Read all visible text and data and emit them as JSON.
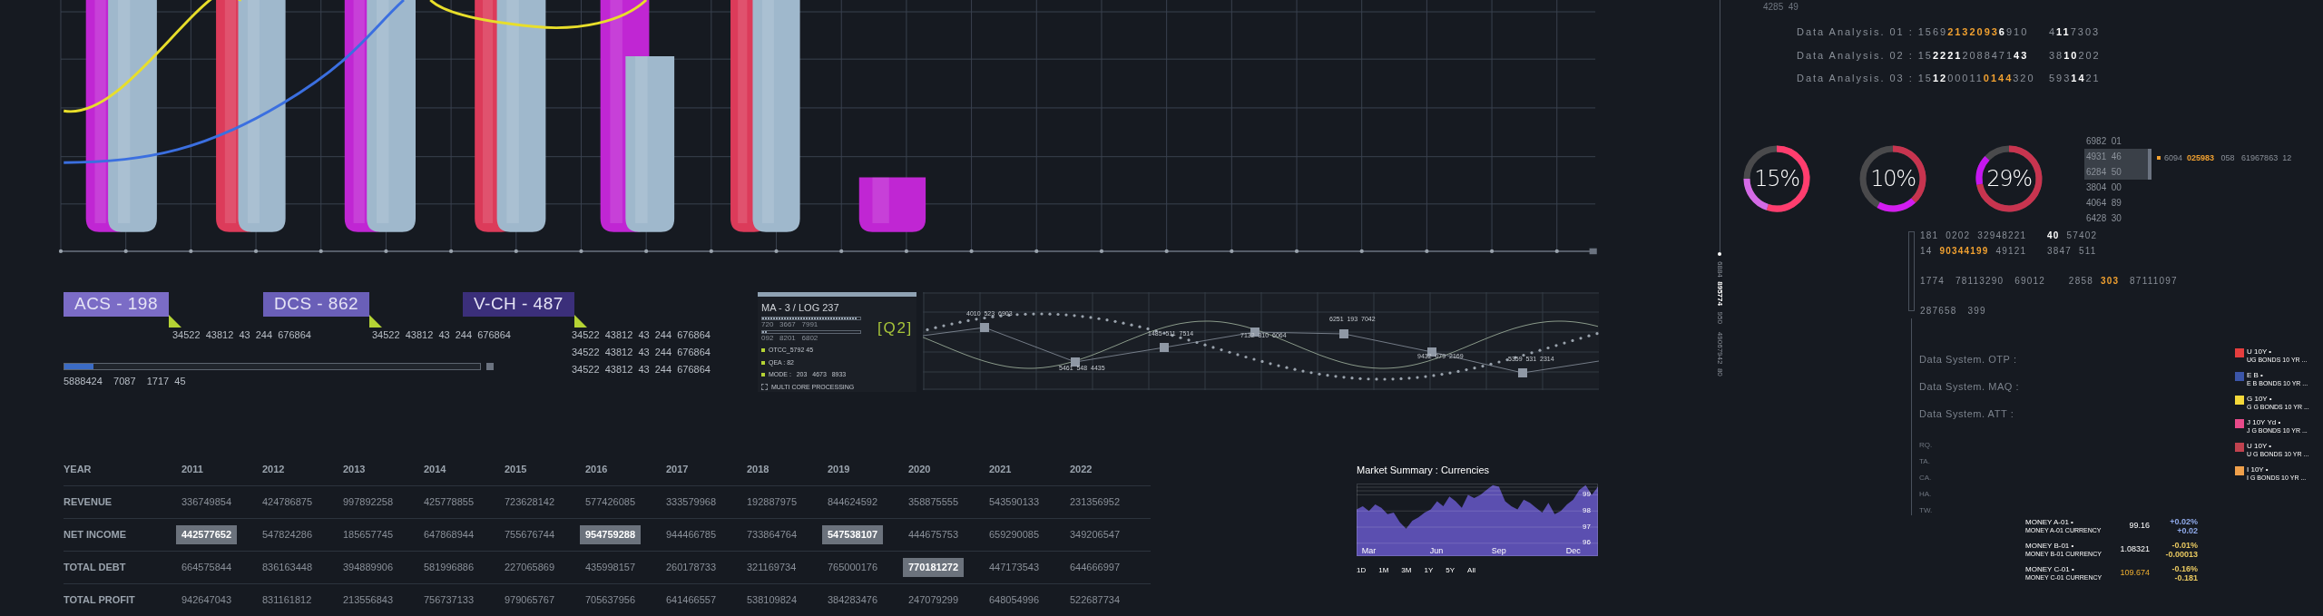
{
  "tags": [
    {
      "label": "ACS - 198",
      "color": "#7b6cc6",
      "lines": [
        "34522  43812  43  244  676864"
      ]
    },
    {
      "label": "DCS - 862",
      "color": "#6a5fb8",
      "lines": [
        "34522  43812  43  244  676864"
      ]
    },
    {
      "label": "V-CH - 487",
      "color": "#3b2f7a",
      "lines": [
        "34522  43812  43  244  676864",
        "34522  43812  43  244  676864",
        "34522  43812  43  244  676864"
      ]
    }
  ],
  "progress": {
    "level": 0.07,
    "reading": "5888424    7087    1717  45"
  },
  "log_panel": {
    "title": "MA - 3 / LOG 237",
    "badge": "[Q2]",
    "meters": [
      {
        "level": 0.97,
        "reading": "720   3667   7991"
      },
      {
        "level": 0.05,
        "reading": "092   8201   6802"
      }
    ],
    "items": [
      {
        "kind": "bullet",
        "text": "OTCC_5792 45"
      },
      {
        "kind": "bullet",
        "text": "QEA : 82"
      },
      {
        "kind": "bullet",
        "text": "MODE :   203   4673   8933"
      },
      {
        "kind": "task",
        "text": "MULTI CORE PROCESSING"
      }
    ]
  },
  "wave_labels": [
    "4010  523  6903",
    "5461  548  4435",
    "1485  511  7514",
    "7132  310  6064",
    "6251  193  7042",
    "9432  079  2169",
    "5359  531  2314"
  ],
  "table": {
    "header": "YEAR",
    "columns": [
      "2011",
      "2012",
      "2013",
      "2014",
      "2015",
      "2016",
      "2017",
      "2018",
      "2019",
      "2020",
      "2021",
      "2022"
    ],
    "rows": [
      {
        "label": "REVENUE",
        "cells": [
          {
            "value": "336749854",
            "highlighted": false
          },
          {
            "value": "424786875",
            "highlighted": false
          },
          {
            "value": "997892258",
            "highlighted": false
          },
          {
            "value": "425778855",
            "highlighted": false
          },
          {
            "value": "723628142",
            "highlighted": false
          },
          {
            "value": "577426085",
            "highlighted": false
          },
          {
            "value": "333579968",
            "highlighted": false
          },
          {
            "value": "192887975",
            "highlighted": false
          },
          {
            "value": "844624592",
            "highlighted": false
          },
          {
            "value": "358875555",
            "highlighted": false
          },
          {
            "value": "543590133",
            "highlighted": false
          },
          {
            "value": "231356952",
            "highlighted": false
          }
        ]
      },
      {
        "label": "NET INCOME",
        "cells": [
          {
            "value": "442577652",
            "highlighted": true
          },
          {
            "value": "547824286",
            "highlighted": false
          },
          {
            "value": "185657745",
            "highlighted": false
          },
          {
            "value": "647868944",
            "highlighted": false
          },
          {
            "value": "755676744",
            "highlighted": false
          },
          {
            "value": "954759288",
            "highlighted": true
          },
          {
            "value": "944466785",
            "highlighted": false
          },
          {
            "value": "733864764",
            "highlighted": false
          },
          {
            "value": "547538107",
            "highlighted": true
          },
          {
            "value": "444675753",
            "highlighted": false
          },
          {
            "value": "659290085",
            "highlighted": false
          },
          {
            "value": "349206547",
            "highlighted": false
          }
        ]
      },
      {
        "label": "TOTAL DEBT",
        "cells": [
          {
            "value": "664575844",
            "highlighted": false
          },
          {
            "value": "836163448",
            "highlighted": false
          },
          {
            "value": "394889906",
            "highlighted": false
          },
          {
            "value": "581996886",
            "highlighted": false
          },
          {
            "value": "227065869",
            "highlighted": false
          },
          {
            "value": "435998157",
            "highlighted": false
          },
          {
            "value": "260178733",
            "highlighted": false
          },
          {
            "value": "321169734",
            "highlighted": false
          },
          {
            "value": "765000176",
            "highlighted": false
          },
          {
            "value": "770181272",
            "highlighted": true
          },
          {
            "value": "447173543",
            "highlighted": false
          },
          {
            "value": "644666997",
            "highlighted": false
          }
        ]
      },
      {
        "label": "TOTAL PROFIT",
        "cells": [
          {
            "value": "942647043",
            "highlighted": false
          },
          {
            "value": "831161812",
            "highlighted": false
          },
          {
            "value": "213556843",
            "highlighted": false
          },
          {
            "value": "756737133",
            "highlighted": false
          },
          {
            "value": "979065767",
            "highlighted": false
          },
          {
            "value": "705637956",
            "highlighted": false
          },
          {
            "value": "641466557",
            "highlighted": false
          },
          {
            "value": "538109824",
            "highlighted": false
          },
          {
            "value": "384283476",
            "highlighted": false
          },
          {
            "value": "247079299",
            "highlighted": false
          },
          {
            "value": "648054996",
            "highlighted": false
          },
          {
            "value": "522687734",
            "highlighted": false
          }
        ]
      }
    ]
  },
  "market": {
    "chart_data": {
      "type": "area",
      "title": "Market Summary : Currencies",
      "values": [
        98.1,
        98.3,
        98.0,
        98.4,
        98.2,
        97.8,
        97.9,
        97.3,
        96.9,
        97.4,
        97.6,
        97.9,
        98.1,
        98.6,
        98.3,
        98.9,
        98.6,
        98.2,
        99.0,
        98.8,
        99.0,
        99.3,
        99.6,
        99.5,
        98.6,
        98.3,
        98.1,
        98.7,
        98.5,
        98.2,
        97.9,
        98.5,
        97.8,
        98.0,
        98.4,
        98.7,
        99.3,
        99.6,
        99.0,
        99.5
      ],
      "categories": [
        null,
        null,
        "Mar",
        null,
        null,
        null,
        null,
        null,
        null,
        null,
        null,
        null,
        null,
        "Jun",
        null,
        null,
        null,
        null,
        null,
        null,
        null,
        null,
        null,
        "Sep",
        null,
        null,
        null,
        null,
        null,
        null,
        null,
        null,
        null,
        null,
        null,
        "Dec",
        null,
        null,
        null,
        null
      ],
      "ylim": [
        95.2,
        99.7
      ],
      "yticks": [
        96,
        97,
        98,
        99
      ],
      "grid": true
    },
    "ranges": [
      "1D",
      "1M",
      "3M",
      "1Y",
      "5Y",
      "All"
    ]
  },
  "side_caption": "4285  49",
  "analysis": [
    {
      "left": [
        {
          "kind": "plain",
          "text": "Data Analysis. 01 : 1569"
        },
        {
          "kind": "accent",
          "text": "2132093"
        },
        {
          "kind": "bold",
          "text": "6"
        },
        {
          "kind": "plain",
          "text": "910"
        }
      ],
      "right": [
        {
          "kind": "plain",
          "text": "4"
        },
        {
          "kind": "bold",
          "text": "11"
        },
        {
          "kind": "plain",
          "text": "7303"
        }
      ]
    },
    {
      "left": [
        {
          "kind": "plain",
          "text": "Data Analysis. 02 : 15"
        },
        {
          "kind": "bold",
          "text": "2221"
        },
        {
          "kind": "plain",
          "text": "2088471"
        },
        {
          "kind": "bold",
          "text": "43"
        }
      ],
      "right": [
        {
          "kind": "plain",
          "text": "38"
        },
        {
          "kind": "bold",
          "text": "10"
        },
        {
          "kind": "plain",
          "text": "202"
        }
      ]
    },
    {
      "left": [
        {
          "kind": "plain",
          "text": "Data Analysis. 03 : 15"
        },
        {
          "kind": "bold",
          "text": "12"
        },
        {
          "kind": "plain",
          "text": "00011"
        },
        {
          "kind": "accent",
          "text": "0144"
        },
        {
          "kind": "plain",
          "text": "320"
        }
      ],
      "right": [
        {
          "kind": "plain",
          "text": "593"
        },
        {
          "kind": "bold",
          "text": "14"
        },
        {
          "kind": "plain",
          "text": "21"
        }
      ]
    }
  ],
  "donuts": [
    {
      "value": "15%"
    },
    {
      "value": "10%"
    },
    {
      "value": "29%"
    }
  ],
  "readings": [
    {
      "text": "6982  01",
      "highlighted": false
    },
    {
      "text": "4931  46",
      "highlighted": true
    },
    {
      "text": "6284  50",
      "highlighted": true
    },
    {
      "text": "3804  00",
      "highlighted": false
    },
    {
      "text": "4064  89",
      "highlighted": false
    },
    {
      "text": "6428  30",
      "highlighted": false
    }
  ],
  "readout": [
    {
      "kind": "plain",
      "text": "6094  "
    },
    {
      "kind": "accent",
      "text": "025983"
    },
    {
      "kind": "plain",
      "text": "   058   61967863  12"
    }
  ],
  "vertical_code": [
    {
      "kind": "plain",
      "text": "6884  "
    },
    {
      "kind": "bold",
      "text": "895774"
    },
    {
      "kind": "plain",
      "text": "   950    49067942  80"
    }
  ],
  "code_rows": [
    {
      "left": [
        {
          "kind": "plain",
          "text": "181  0202  32948221"
        }
      ],
      "right": [
        {
          "kind": "bold",
          "text": "40"
        },
        {
          "kind": "plain",
          "text": "  57402"
        }
      ]
    },
    {
      "left": [
        {
          "kind": "plain",
          "text": "14  "
        },
        {
          "kind": "accent",
          "text": "90344199"
        },
        {
          "kind": "plain",
          "text": "  49121"
        }
      ],
      "right": [
        {
          "kind": "plain",
          "text": "3847  511"
        }
      ]
    },
    {
      "left": [
        {
          "kind": "plain",
          "text": "1774   78113290   69012"
        }
      ],
      "right": [
        {
          "kind": "plain",
          "text": "      2858  "
        },
        {
          "kind": "accent",
          "text": "303"
        },
        {
          "kind": "plain",
          "text": "   87111097"
        }
      ]
    },
    {
      "left": [
        {
          "kind": "plain",
          "text": "287658   399"
        }
      ],
      "right": []
    }
  ],
  "systems": [
    "Data System. OTP :",
    "Data System. MAQ :",
    "Data System. ATT :"
  ],
  "codes": [
    "RQ.",
    "TA.",
    "CA.",
    "HA.",
    "TW."
  ],
  "money": [
    {
      "name": "MONEY A-01 •",
      "sub": "MONEY A-01 CURRENCY",
      "price": "99.16",
      "highlighted": false,
      "color": "#8ea8e8",
      "pct": "+0.02%",
      "change": "+0.02"
    },
    {
      "name": "MONEY B-01 •",
      "sub": "MONEY B-01 CURRENCY",
      "price": "1.08321",
      "highlighted": false,
      "color": "#e8c860",
      "pct": "-0.01%",
      "change": "-0.00013"
    },
    {
      "name": "MONEY C-01 •",
      "sub": "MONEY C-01 CURRENCY",
      "price": "109.674",
      "highlighted": true,
      "color": "#e8c860",
      "pct": "-0.16%",
      "change": "-0.181"
    }
  ],
  "legend": [
    {
      "code": "U 10Y •",
      "sub": "UG BONDS 10 YR ...",
      "color": "#e53e3e"
    },
    {
      "code": "E B •",
      "sub": "E B BONDS 10 YR ...",
      "color": "#3b55a8"
    },
    {
      "code": "G 10Y •",
      "sub": "G G BONDS 10 YR ...",
      "color": "#f5d93a"
    },
    {
      "code": "J 10Y Yd •",
      "sub": "J G BONDS 10 YR ...",
      "color": "#e84a8a"
    },
    {
      "code": "U 10Y •",
      "sub": "U G BONDS 10 YR ...",
      "color": "#c0424f"
    },
    {
      "code": "I 10Y •",
      "sub": "I G BONDS 10 YR ...",
      "color": "#f0a04b"
    }
  ]
}
